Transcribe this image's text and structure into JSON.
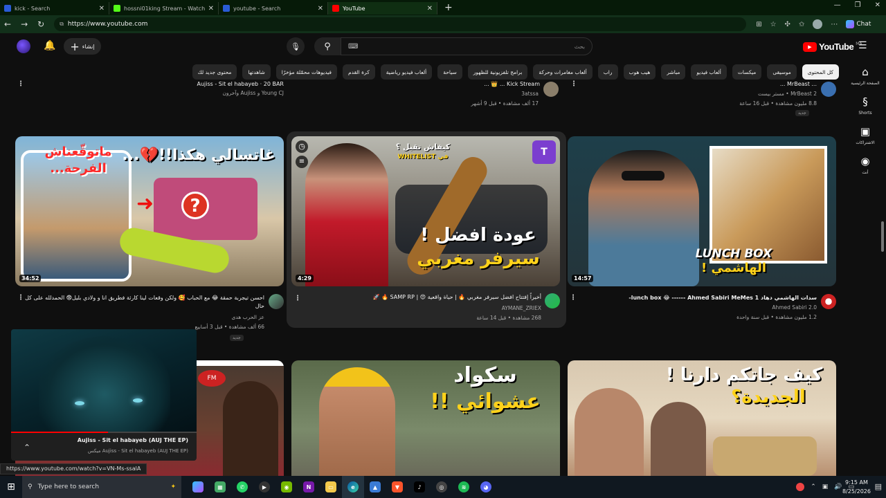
{
  "browser": {
    "tabs": [
      {
        "title": "kick - Search",
        "fav_color": "#2a5bd7"
      },
      {
        "title": "hossni01king Stream - Watch",
        "fav_color": "#53fc18"
      },
      {
        "title": "youtube - Search",
        "fav_color": "#2a5bd7"
      },
      {
        "title": "YouTube",
        "fav_color": "#ff0000",
        "active": true
      }
    ],
    "url": "https://www.youtube.com",
    "chat_label": "Chat"
  },
  "yt": {
    "create_label": "إنشاء",
    "search_placeholder": "بحث",
    "logo_text": "YouTube",
    "logo_cc": "MA",
    "chips": [
      "كل المحتوى",
      "موسيقى",
      "ميكسات",
      "ألعاب فيديو",
      "مباشر",
      "هيب هوب",
      "راب",
      "ألعاب مغامرات وحركة",
      "برامج تلفزيونية للظهور",
      "سياحة",
      "ألعاب فيديو رياضية",
      "كرة القدم",
      "فيديوهات محمّلة مؤخرًا",
      "شاهدتها",
      "محتوى جديد لك"
    ],
    "rail": [
      {
        "label": "الصفحة الرئيسية",
        "icon": "home-icon",
        "glyph": "⌂"
      },
      {
        "label": "Shorts",
        "icon": "shorts-icon",
        "glyph": "§"
      },
      {
        "label": "الاشتراكات",
        "icon": "subscriptions-icon",
        "glyph": "▣"
      },
      {
        "label": "أنت",
        "icon": "you-icon",
        "glyph": "◉"
      }
    ]
  },
  "top_partial": [
    {
      "title": "Aujiss - Sit el habayeb · 20 BAR",
      "channel": "Young CJ و Aujiss وآخرون",
      "meta": ""
    },
    {
      "title": "Kick Stream ... 👑 ...",
      "channel": "3atssa",
      "meta": "17 ألف مشاهدة • قبل 9 أشهر"
    },
    {
      "title": "... MrBeast ...",
      "channel": "MrBeast 2 • مستر بيست",
      "meta": "8.8 مليون مشاهدة • قبل 16 ساعة",
      "badge": "جديد"
    }
  ],
  "videos": [
    {
      "overlay": [
        "غاتسالي هكذا!!💔...",
        "ماتوقّعناش",
        "الفرحة..."
      ],
      "duration": "34:52",
      "title": "احسن تيجربة حمقة 😂 مع الحباب 🥰 ولكن وقعات لينا كارثة فطريق انا و ولادي بليل😨 الحمدلله على كل حال",
      "channel": "عز الحرب هدى",
      "meta": "66 ألف مشاهدة • قبل 3 أسابيع",
      "badge": "جديد"
    },
    {
      "overlay": [
        "كيفاش تقبل ؟",
        "في WHITELIST",
        "عودة افضل !",
        "سيرفر مغربي"
      ],
      "duration": "4:29",
      "title": "أخيراً إفتتاح افضل سيرفر مغربي 🔥 | حياة واقعية 😍 | SAMP RP 🔥 🚀",
      "channel": "AYMANE_ZRIEX",
      "meta": "268 مشاهدة • قبل 14 ساعة"
    },
    {
      "overlay": [
        "LUNCH BOX",
        "الهاشمي !"
      ],
      "duration": "14:57",
      "title": "سدات الهاشمي دهاد lunch box 😂 ------ Ahmed Sabiri MeMes 1-",
      "channel": "Ahmed Sabiri 2.0",
      "meta": "1.2 مليون مشاهدة • قبل سنة واحدة"
    },
    {
      "overlay": [],
      "duration": "",
      "title": "",
      "channel": "",
      "meta": ""
    },
    {
      "overlay": [
        "سكواد",
        "عشوائي !!"
      ],
      "duration": "",
      "title": "",
      "channel": "",
      "meta": ""
    },
    {
      "overlay": [
        "كيف جاتكم دارنا !",
        "الجديدة؟"
      ],
      "duration": "",
      "title": "",
      "channel": "",
      "meta": ""
    }
  ],
  "miniplayer": {
    "title": "Aujiss - Sit el habayeb (AUJ THE EP)",
    "subtitle": "Aujiss - Sit el habayeb (AUJ THE EP) ميكس"
  },
  "status_url": "https://www.youtube.com/watch?v=VN-Ms-ssalA",
  "taskbar": {
    "search_placeholder": "Type here to search",
    "time": "9:15 AM",
    "date": "8/25/2026"
  }
}
